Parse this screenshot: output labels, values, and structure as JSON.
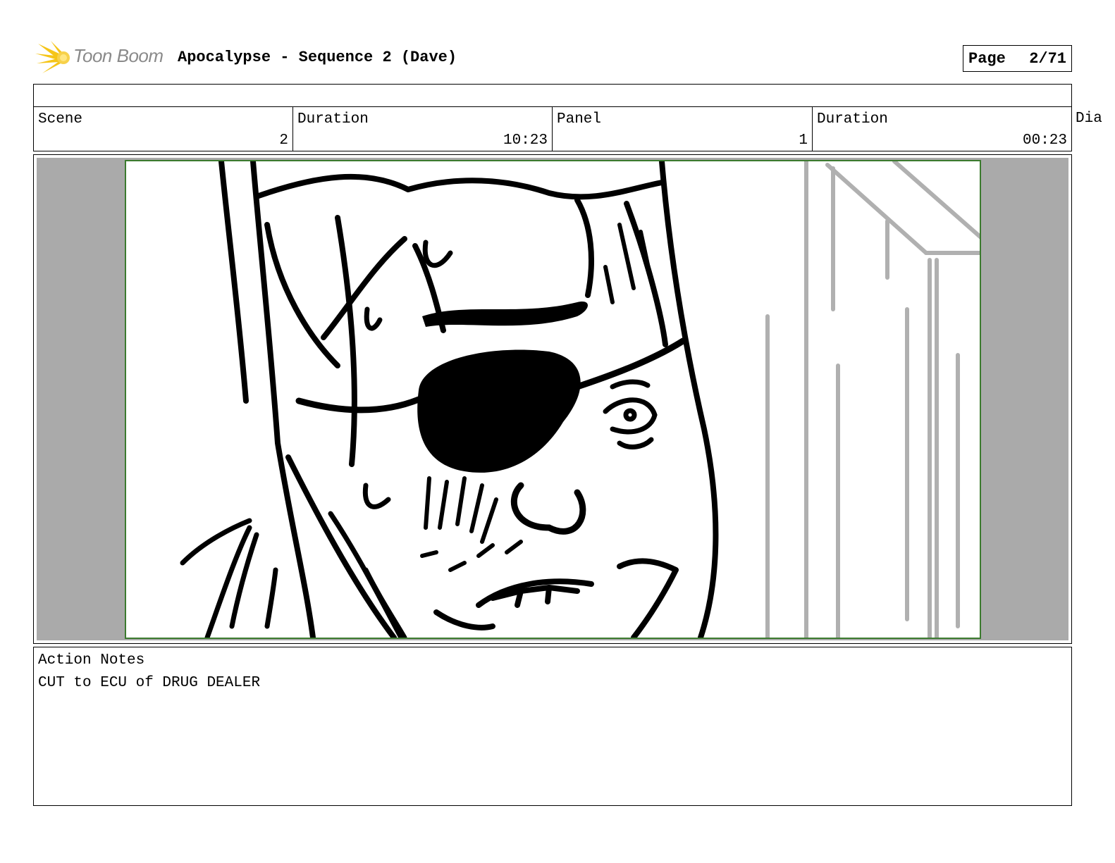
{
  "header": {
    "logo_text": "Toon Boom",
    "title": "Apocalypse - Sequence 2 (Dave)",
    "page_label": "Page",
    "page_number": "2/71"
  },
  "info": {
    "scene_label": "Scene",
    "scene_value": "2",
    "scene_duration_label": "Duration",
    "scene_duration_value": "10:23",
    "panel_label": "Panel",
    "panel_value": "1",
    "panel_duration_label": "Duration",
    "panel_duration_value": "00:23",
    "dialogue_label": "Dia"
  },
  "notes": {
    "label": "Action Notes",
    "text": "CUT to ECU of DRUG DEALER"
  },
  "colors": {
    "frame_border": "#3b7a2e",
    "letterbox": "#aaaaaa",
    "logo_accent": "#f5c518"
  },
  "icons": {
    "logo": "toon-boom-starburst-icon"
  }
}
